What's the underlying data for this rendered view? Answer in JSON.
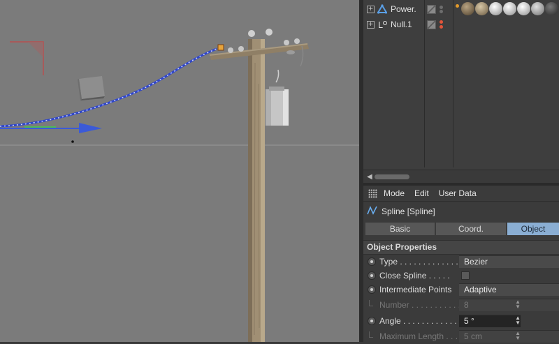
{
  "object_manager": {
    "objects": [
      {
        "name": "Power.",
        "expanded": false,
        "icon": "triangle-object-icon"
      },
      {
        "name": "Null.1",
        "expanded": false,
        "icon": "null-object-icon"
      }
    ],
    "materials": [
      "orange-material",
      "dark-bronze-material",
      "bronze-material",
      "silver-material",
      "silver-material",
      "silver-material",
      "dark-material"
    ]
  },
  "attribute_manager": {
    "menu": [
      "Mode",
      "Edit",
      "User Data"
    ],
    "object_title": "Spline [Spline]",
    "tabs": [
      "Basic",
      "Coord.",
      "Object"
    ],
    "active_tab": "Object",
    "section_title": "Object Properties",
    "properties": [
      {
        "label": "Type . . . . . . . . . . . . . .",
        "value": "Bezier",
        "enabled": true
      },
      {
        "label": "Close Spline . . . . .",
        "value": "",
        "enabled": true
      },
      {
        "label": "Intermediate Points",
        "value": "Adaptive",
        "enabled": true
      },
      {
        "label": "Number . . . . . . . . . . .",
        "value": "8",
        "enabled": false
      },
      {
        "label": "Angle . . . . . . . . . . . . .",
        "value": "5 °",
        "enabled": true
      },
      {
        "label": "Maximum Length . . .",
        "value": "5 cm",
        "enabled": false
      }
    ]
  },
  "colors": {
    "viewport_bg": "#7b7b7b",
    "spline_blue": "#3f57d6",
    "active_tab": "#8aaed3",
    "panel_bg": "#3b3b3b"
  }
}
